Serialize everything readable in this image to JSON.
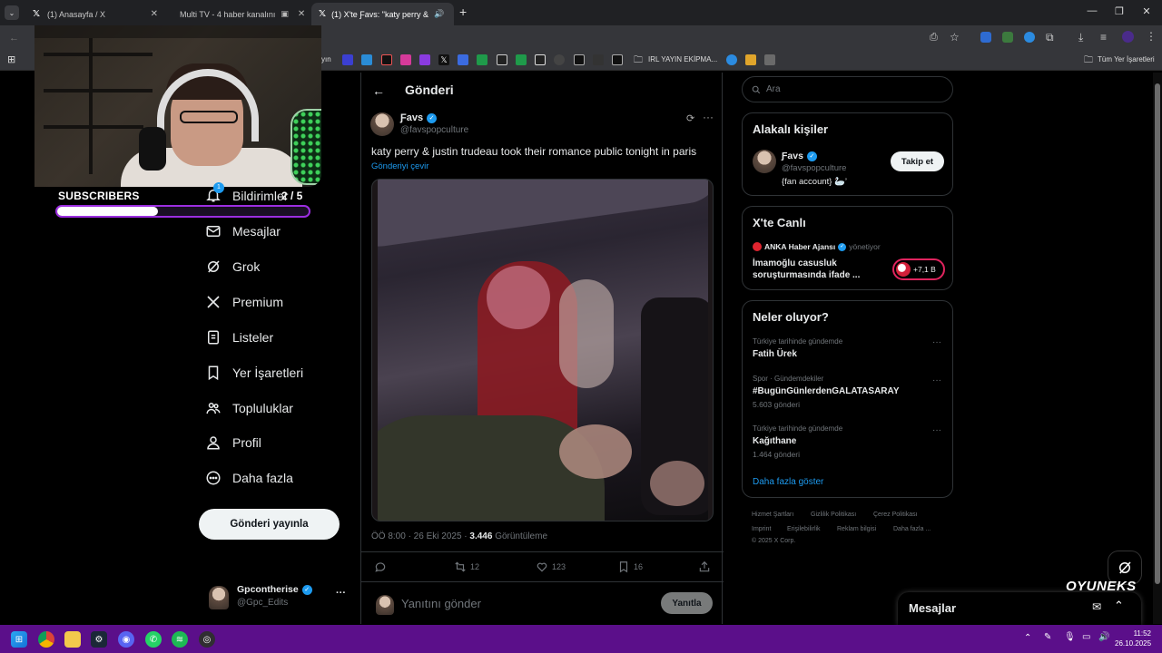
{
  "browser": {
    "tabs": [
      {
        "label": "(1) Anasayfa / X",
        "active": false
      },
      {
        "label": "Multi TV - 4 haber kanalını",
        "active": false
      },
      {
        "label": "(1) X'te Ƒavs: \"katy perry &",
        "active": true
      }
    ],
    "new_tab": "+",
    "bookmarks": {
      "folder1": "IRL YAYIN EKİPMA...",
      "all_bookmarks": "Tüm Yer İşaretleri",
      "partial": "yın"
    }
  },
  "stream_overlay": {
    "subscribers_label": "SUBSCRIBERS",
    "subscribers_count": "2 / 5",
    "subscribers_progress": 0.4,
    "brand": "OYUNEKS"
  },
  "sidebar": {
    "items": [
      {
        "label": "Bildirimler",
        "icon": "bell-icon",
        "badge": "1"
      },
      {
        "label": "Mesajlar",
        "icon": "mail-icon"
      },
      {
        "label": "Grok",
        "icon": "grok-icon"
      },
      {
        "label": "Premium",
        "icon": "x-logo-icon"
      },
      {
        "label": "Listeler",
        "icon": "list-icon"
      },
      {
        "label": "Yer İşaretleri",
        "icon": "bookmark-icon"
      },
      {
        "label": "Topluluklar",
        "icon": "communities-icon"
      },
      {
        "label": "Profil",
        "icon": "profile-icon"
      },
      {
        "label": "Daha fazla",
        "icon": "more-circle-icon"
      }
    ],
    "post_button": "Gönderi yayınla",
    "account": {
      "name": "Gpcontherise",
      "handle": "@Gpc_Edits",
      "more": "···"
    }
  },
  "main": {
    "title": "Gönderi",
    "tweet": {
      "author": "Ƒavs",
      "handle": "@favspopculture",
      "text": "katy perry & justin trudeau took their romance public tonight in paris",
      "translate": "Gönderiyi çevir",
      "time": "ÖÖ 8:00 · 26 Eki 2025 · ",
      "views_count": "3.446",
      "views_label": "Görüntüleme",
      "retweets": "12",
      "likes": "123",
      "bookmarks": "16"
    },
    "reply": {
      "placeholder": "Yanıtını gönder",
      "button": "Yanıtla"
    }
  },
  "right": {
    "search_placeholder": "Ara",
    "relevant": {
      "title": "Alakalı kişiler",
      "name": "Ƒavs",
      "handle": "@favspopculture",
      "bio": "{fan account} 🦢’",
      "follow": "Takip et"
    },
    "live": {
      "title": "X'te Canlı",
      "host": "ANKA Haber Ajansı",
      "host_suffix": "yönetiyor",
      "topic": "İmamoğlu casusluk soruşturmasında ifade ...",
      "listeners": "+7,1 B"
    },
    "trends": {
      "title": "Neler oluyor?",
      "items": [
        {
          "category": "Türkiye tarihinde gündemde",
          "name": "Fatih Ürek",
          "count": ""
        },
        {
          "category": "Spor · Gündemdekiler",
          "name": "#BugünGünlerdenGALATASARAY",
          "count": "5.603 gönderi"
        },
        {
          "category": "Türkiye tarihinde gündemde",
          "name": "Kağıthane",
          "count": "1.464 gönderi"
        }
      ],
      "show_more": "Daha fazla göster"
    },
    "footer": {
      "l1": "Hizmet Şartları",
      "l2": "Gizlilik Politikası",
      "l3": "Çerez Politikası",
      "l4": "Imprint",
      "l5": "Erişilebilirlik",
      "l6": "Reklam bilgisi",
      "l7": "Daha fazla ...",
      "copyright": "© 2025 X Corp."
    }
  },
  "messages_drawer": {
    "title": "Mesajlar"
  },
  "taskbar": {
    "time": "11:52",
    "date": "26.10.2025"
  },
  "colors": {
    "accent": "#1d9bf0",
    "taskbar": "#5b0f8a",
    "subs_border": "#9c2ee0"
  }
}
